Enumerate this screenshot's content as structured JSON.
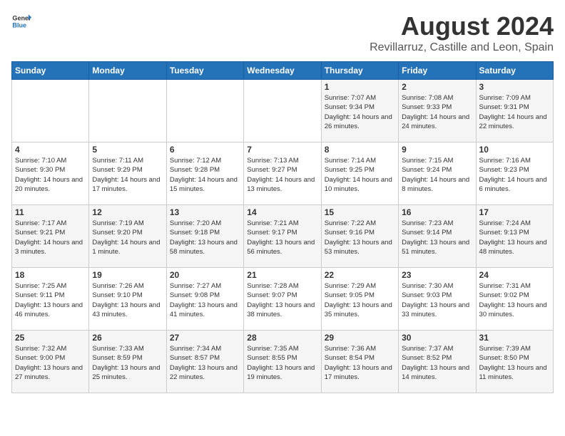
{
  "logo": {
    "text_general": "General",
    "text_blue": "Blue"
  },
  "header": {
    "month_year": "August 2024",
    "location": "Revillarruz, Castille and Leon, Spain"
  },
  "weekdays": [
    "Sunday",
    "Monday",
    "Tuesday",
    "Wednesday",
    "Thursday",
    "Friday",
    "Saturday"
  ],
  "weeks": [
    [
      {
        "day": "",
        "sunrise": "",
        "sunset": "",
        "daylight": ""
      },
      {
        "day": "",
        "sunrise": "",
        "sunset": "",
        "daylight": ""
      },
      {
        "day": "",
        "sunrise": "",
        "sunset": "",
        "daylight": ""
      },
      {
        "day": "",
        "sunrise": "",
        "sunset": "",
        "daylight": ""
      },
      {
        "day": "1",
        "sunrise": "Sunrise: 7:07 AM",
        "sunset": "Sunset: 9:34 PM",
        "daylight": "Daylight: 14 hours and 26 minutes."
      },
      {
        "day": "2",
        "sunrise": "Sunrise: 7:08 AM",
        "sunset": "Sunset: 9:33 PM",
        "daylight": "Daylight: 14 hours and 24 minutes."
      },
      {
        "day": "3",
        "sunrise": "Sunrise: 7:09 AM",
        "sunset": "Sunset: 9:31 PM",
        "daylight": "Daylight: 14 hours and 22 minutes."
      }
    ],
    [
      {
        "day": "4",
        "sunrise": "Sunrise: 7:10 AM",
        "sunset": "Sunset: 9:30 PM",
        "daylight": "Daylight: 14 hours and 20 minutes."
      },
      {
        "day": "5",
        "sunrise": "Sunrise: 7:11 AM",
        "sunset": "Sunset: 9:29 PM",
        "daylight": "Daylight: 14 hours and 17 minutes."
      },
      {
        "day": "6",
        "sunrise": "Sunrise: 7:12 AM",
        "sunset": "Sunset: 9:28 PM",
        "daylight": "Daylight: 14 hours and 15 minutes."
      },
      {
        "day": "7",
        "sunrise": "Sunrise: 7:13 AM",
        "sunset": "Sunset: 9:27 PM",
        "daylight": "Daylight: 14 hours and 13 minutes."
      },
      {
        "day": "8",
        "sunrise": "Sunrise: 7:14 AM",
        "sunset": "Sunset: 9:25 PM",
        "daylight": "Daylight: 14 hours and 10 minutes."
      },
      {
        "day": "9",
        "sunrise": "Sunrise: 7:15 AM",
        "sunset": "Sunset: 9:24 PM",
        "daylight": "Daylight: 14 hours and 8 minutes."
      },
      {
        "day": "10",
        "sunrise": "Sunrise: 7:16 AM",
        "sunset": "Sunset: 9:23 PM",
        "daylight": "Daylight: 14 hours and 6 minutes."
      }
    ],
    [
      {
        "day": "11",
        "sunrise": "Sunrise: 7:17 AM",
        "sunset": "Sunset: 9:21 PM",
        "daylight": "Daylight: 14 hours and 3 minutes."
      },
      {
        "day": "12",
        "sunrise": "Sunrise: 7:19 AM",
        "sunset": "Sunset: 9:20 PM",
        "daylight": "Daylight: 14 hours and 1 minute."
      },
      {
        "day": "13",
        "sunrise": "Sunrise: 7:20 AM",
        "sunset": "Sunset: 9:18 PM",
        "daylight": "Daylight: 13 hours and 58 minutes."
      },
      {
        "day": "14",
        "sunrise": "Sunrise: 7:21 AM",
        "sunset": "Sunset: 9:17 PM",
        "daylight": "Daylight: 13 hours and 56 minutes."
      },
      {
        "day": "15",
        "sunrise": "Sunrise: 7:22 AM",
        "sunset": "Sunset: 9:16 PM",
        "daylight": "Daylight: 13 hours and 53 minutes."
      },
      {
        "day": "16",
        "sunrise": "Sunrise: 7:23 AM",
        "sunset": "Sunset: 9:14 PM",
        "daylight": "Daylight: 13 hours and 51 minutes."
      },
      {
        "day": "17",
        "sunrise": "Sunrise: 7:24 AM",
        "sunset": "Sunset: 9:13 PM",
        "daylight": "Daylight: 13 hours and 48 minutes."
      }
    ],
    [
      {
        "day": "18",
        "sunrise": "Sunrise: 7:25 AM",
        "sunset": "Sunset: 9:11 PM",
        "daylight": "Daylight: 13 hours and 46 minutes."
      },
      {
        "day": "19",
        "sunrise": "Sunrise: 7:26 AM",
        "sunset": "Sunset: 9:10 PM",
        "daylight": "Daylight: 13 hours and 43 minutes."
      },
      {
        "day": "20",
        "sunrise": "Sunrise: 7:27 AM",
        "sunset": "Sunset: 9:08 PM",
        "daylight": "Daylight: 13 hours and 41 minutes."
      },
      {
        "day": "21",
        "sunrise": "Sunrise: 7:28 AM",
        "sunset": "Sunset: 9:07 PM",
        "daylight": "Daylight: 13 hours and 38 minutes."
      },
      {
        "day": "22",
        "sunrise": "Sunrise: 7:29 AM",
        "sunset": "Sunset: 9:05 PM",
        "daylight": "Daylight: 13 hours and 35 minutes."
      },
      {
        "day": "23",
        "sunrise": "Sunrise: 7:30 AM",
        "sunset": "Sunset: 9:03 PM",
        "daylight": "Daylight: 13 hours and 33 minutes."
      },
      {
        "day": "24",
        "sunrise": "Sunrise: 7:31 AM",
        "sunset": "Sunset: 9:02 PM",
        "daylight": "Daylight: 13 hours and 30 minutes."
      }
    ],
    [
      {
        "day": "25",
        "sunrise": "Sunrise: 7:32 AM",
        "sunset": "Sunset: 9:00 PM",
        "daylight": "Daylight: 13 hours and 27 minutes."
      },
      {
        "day": "26",
        "sunrise": "Sunrise: 7:33 AM",
        "sunset": "Sunset: 8:59 PM",
        "daylight": "Daylight: 13 hours and 25 minutes."
      },
      {
        "day": "27",
        "sunrise": "Sunrise: 7:34 AM",
        "sunset": "Sunset: 8:57 PM",
        "daylight": "Daylight: 13 hours and 22 minutes."
      },
      {
        "day": "28",
        "sunrise": "Sunrise: 7:35 AM",
        "sunset": "Sunset: 8:55 PM",
        "daylight": "Daylight: 13 hours and 19 minutes."
      },
      {
        "day": "29",
        "sunrise": "Sunrise: 7:36 AM",
        "sunset": "Sunset: 8:54 PM",
        "daylight": "Daylight: 13 hours and 17 minutes."
      },
      {
        "day": "30",
        "sunrise": "Sunrise: 7:37 AM",
        "sunset": "Sunset: 8:52 PM",
        "daylight": "Daylight: 13 hours and 14 minutes."
      },
      {
        "day": "31",
        "sunrise": "Sunrise: 7:39 AM",
        "sunset": "Sunset: 8:50 PM",
        "daylight": "Daylight: 13 hours and 11 minutes."
      }
    ]
  ]
}
